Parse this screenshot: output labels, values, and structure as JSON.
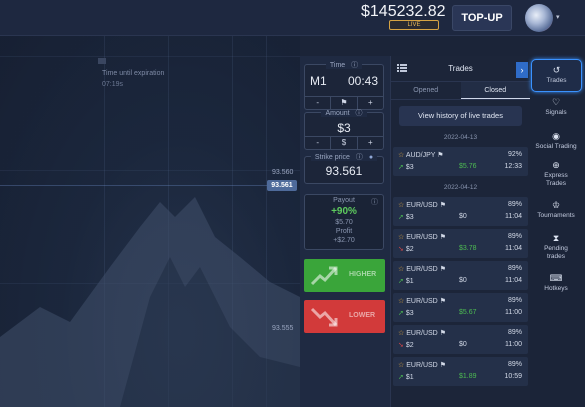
{
  "header": {
    "balance": "$145232.82",
    "account_mode": "LIVE",
    "topup_label": "TOP-UP"
  },
  "chart": {
    "expiry_label": "Time until expiration",
    "expiry_value": "07:19s",
    "current_price": "93.561",
    "axis_prices": [
      "93.560",
      "93.555"
    ]
  },
  "trade_panel": {
    "time_title": "Time",
    "timeframe": "M1",
    "time_value": "00:43",
    "amount_title": "Amount",
    "amount_value": "$3",
    "strike_title": "Strike price",
    "strike_value": "93.561",
    "payout_title": "Payout",
    "payout_pct": "+90%",
    "payout_amount": "$5.70",
    "profit_label": "Profit",
    "profit_value": "+$2.70",
    "higher_label": "HIGHER",
    "lower_label": "LOWER"
  },
  "trades": {
    "title": "Trades",
    "tabs": [
      "Opened",
      "Closed"
    ],
    "active_tab": "Closed",
    "history_button": "View history of live trades",
    "groups": [
      {
        "date": "2022-04-13",
        "rows": [
          {
            "pair": "AUD/JPY",
            "pct": "92%",
            "amount": "$3",
            "profit": "$5.76",
            "time": "12:33",
            "direction": "up",
            "won": true
          }
        ]
      },
      {
        "date": "2022-04-12",
        "rows": [
          {
            "pair": "EUR/USD",
            "pct": "89%",
            "amount": "$3",
            "profit": "$0",
            "time": "11:04",
            "direction": "up",
            "won": false
          },
          {
            "pair": "EUR/USD",
            "pct": "89%",
            "amount": "$2",
            "profit": "$3.78",
            "time": "11:04",
            "direction": "down",
            "won": true
          },
          {
            "pair": "EUR/USD",
            "pct": "89%",
            "amount": "$1",
            "profit": "$0",
            "time": "11:04",
            "direction": "up",
            "won": false
          },
          {
            "pair": "EUR/USD",
            "pct": "89%",
            "amount": "$3",
            "profit": "$5.67",
            "time": "11:00",
            "direction": "up",
            "won": true
          },
          {
            "pair": "EUR/USD",
            "pct": "89%",
            "amount": "$2",
            "profit": "$0",
            "time": "11:00",
            "direction": "down",
            "won": false
          },
          {
            "pair": "EUR/USD",
            "pct": "89%",
            "amount": "$1",
            "profit": "$1.89",
            "time": "10:59",
            "direction": "up",
            "won": true
          }
        ]
      }
    ]
  },
  "sidebar": {
    "items": [
      {
        "label": "Trades",
        "icon": "history-icon",
        "active": true
      },
      {
        "label": "Signals",
        "icon": "signals-icon",
        "active": false
      },
      {
        "label": "Social Trading",
        "icon": "social-trading-icon",
        "active": false
      },
      {
        "label": "Express Trades",
        "icon": "express-trades-icon",
        "active": false
      },
      {
        "label": "Tournaments",
        "icon": "trophy-icon",
        "active": false
      },
      {
        "label": "Pending trades",
        "icon": "hourglass-icon",
        "active": false
      },
      {
        "label": "Hotkeys",
        "icon": "keyboard-icon",
        "active": false
      }
    ]
  },
  "colors": {
    "win": "#4dbb52",
    "loss": "#d64747",
    "accent": "#3a92ff",
    "higher": "#3aa53a",
    "lower": "#d23a3a"
  }
}
